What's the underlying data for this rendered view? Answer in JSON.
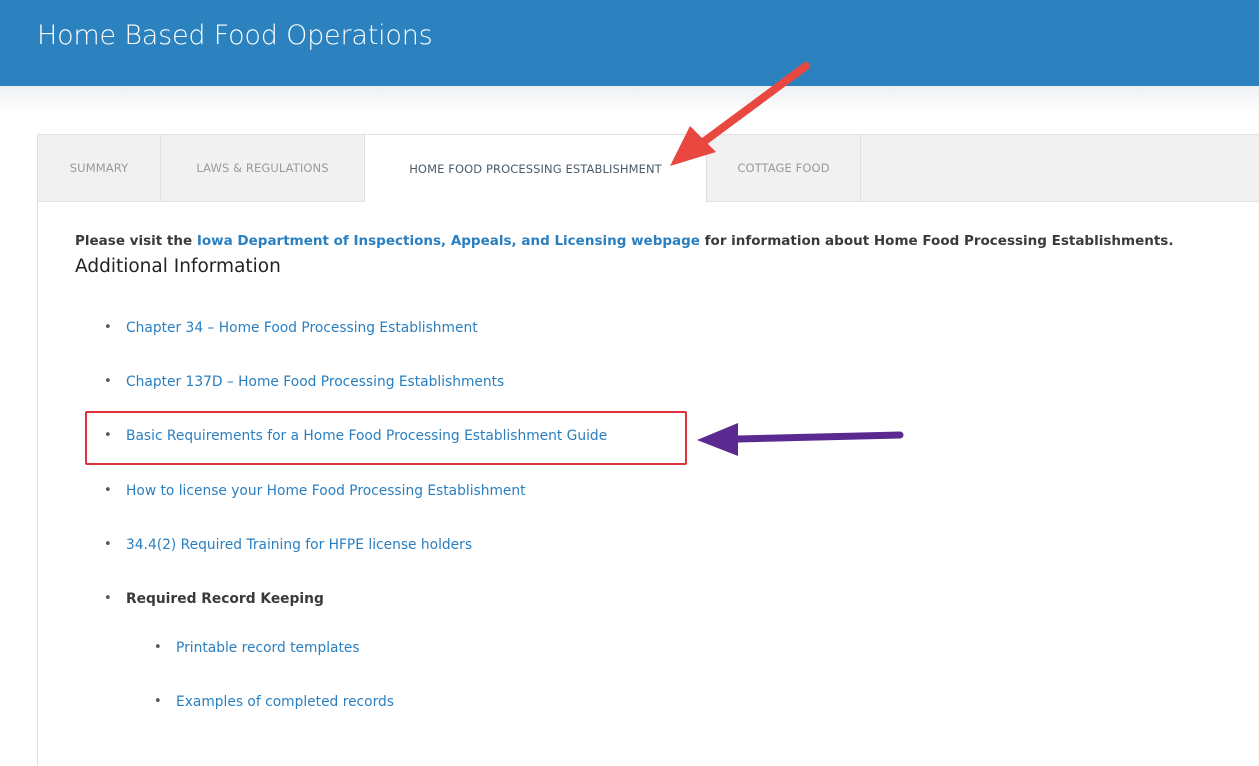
{
  "header": {
    "title": "Home Based Food Operations"
  },
  "tabs": [
    {
      "label": "SUMMARY"
    },
    {
      "label": "LAWS & REGULATIONS"
    },
    {
      "label": "HOME FOOD PROCESSING ESTABLISHMENT",
      "active": true
    },
    {
      "label": "COTTAGE FOOD"
    }
  ],
  "intro": {
    "prefix": "Please visit the ",
    "link": "Iowa Department of Inspections, Appeals, and Licensing webpage",
    "suffix": " for information about Home Food Processing Establishments."
  },
  "section": {
    "heading": "Additional Information"
  },
  "items": [
    {
      "text": "Chapter 34 – Home Food Processing Establishment"
    },
    {
      "text": "Chapter 137D – Home Food Processing Establishments"
    },
    {
      "text": "Basic Requirements  for a Home Food Processing Establishment Guide"
    },
    {
      "text": "How to license your Home Food Processing Establishment"
    },
    {
      "text": "34.4(2) Required Training for HFPE license holders"
    },
    {
      "text": "Required Record Keeping"
    }
  ],
  "subitems": [
    {
      "text": "Printable record templates"
    },
    {
      "text": "Examples of completed records"
    }
  ],
  "colors": {
    "header_bg": "#2b82be",
    "link": "#2a7fc0",
    "highlight_box": "#e0323c",
    "red_arrow": "#e8483f",
    "purple_arrow": "#5b2a90"
  }
}
